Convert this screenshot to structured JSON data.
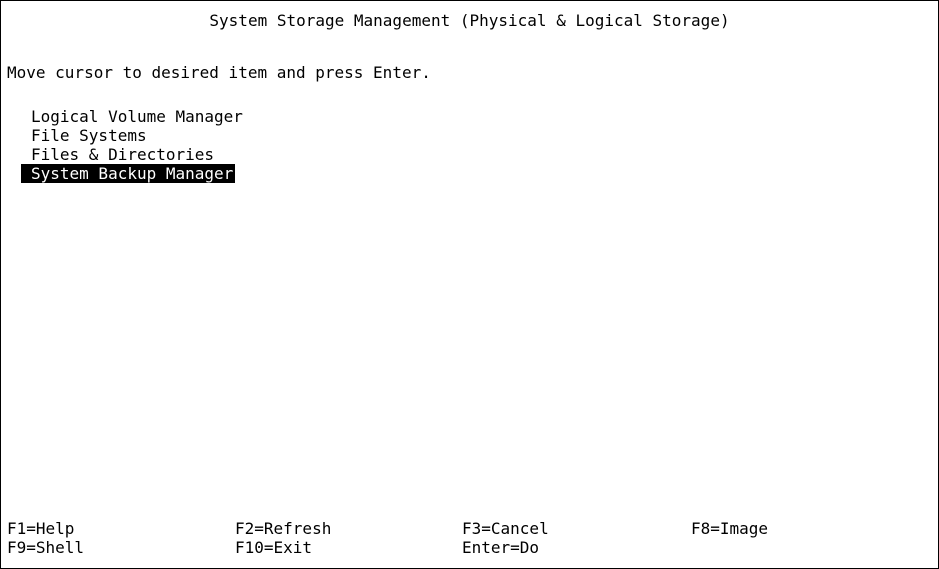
{
  "screen": {
    "title": "System Storage Management (Physical & Logical Storage)",
    "instruction": "Move cursor to desired item and press Enter."
  },
  "menu": {
    "items": [
      {
        "label": "Logical Volume Manager",
        "selected": false
      },
      {
        "label": "File Systems",
        "selected": false
      },
      {
        "label": "Files & Directories",
        "selected": false
      },
      {
        "label": "System Backup Manager",
        "selected": true
      }
    ]
  },
  "function_keys": [
    {
      "label": "F1=Help"
    },
    {
      "label": "F2=Refresh"
    },
    {
      "label": "F3=Cancel"
    },
    {
      "label": "F8=Image"
    },
    {
      "label": "F9=Shell"
    },
    {
      "label": "F10=Exit"
    },
    {
      "label": "Enter=Do"
    }
  ],
  "colors": {
    "background": "#ffffff",
    "foreground": "#000000",
    "highlight_background": "#000000",
    "highlight_foreground": "#ffffff"
  }
}
